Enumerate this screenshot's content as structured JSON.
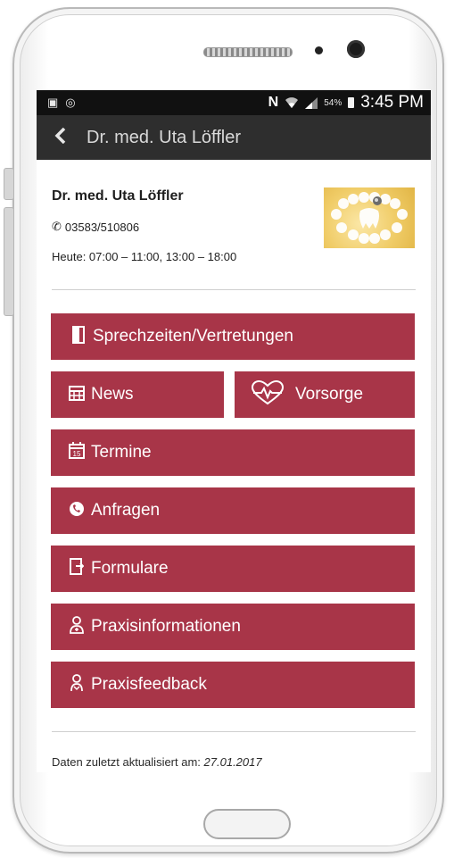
{
  "statusbar": {
    "left_icons": [
      "image-icon",
      "instagram-icon"
    ],
    "nfc": "N",
    "battery_pct": "54%",
    "time": "3:45 PM"
  },
  "appbar": {
    "title": "Dr. med. Uta Löffler"
  },
  "doctor": {
    "name": "Dr. med. Uta Löffler",
    "phone": "03583/510806",
    "hours": "Heute: 07:00 – 11:00, 13:00 – 18:00"
  },
  "menu": {
    "sprechzeiten": "Sprechzeiten/Vertretungen",
    "news": "News",
    "vorsorge": "Vorsorge",
    "termine": "Termine",
    "anfragen": "Anfragen",
    "formulare": "Formulare",
    "praxisinformationen": "Praxisinformationen",
    "praxisfeedback": "Praxisfeedback"
  },
  "footer": {
    "label": "Daten zuletzt aktualisiert am:",
    "date": "27.01.2017"
  },
  "colors": {
    "accent": "#a83548",
    "appbar": "#2e2e2e",
    "statusbar": "#111111"
  }
}
